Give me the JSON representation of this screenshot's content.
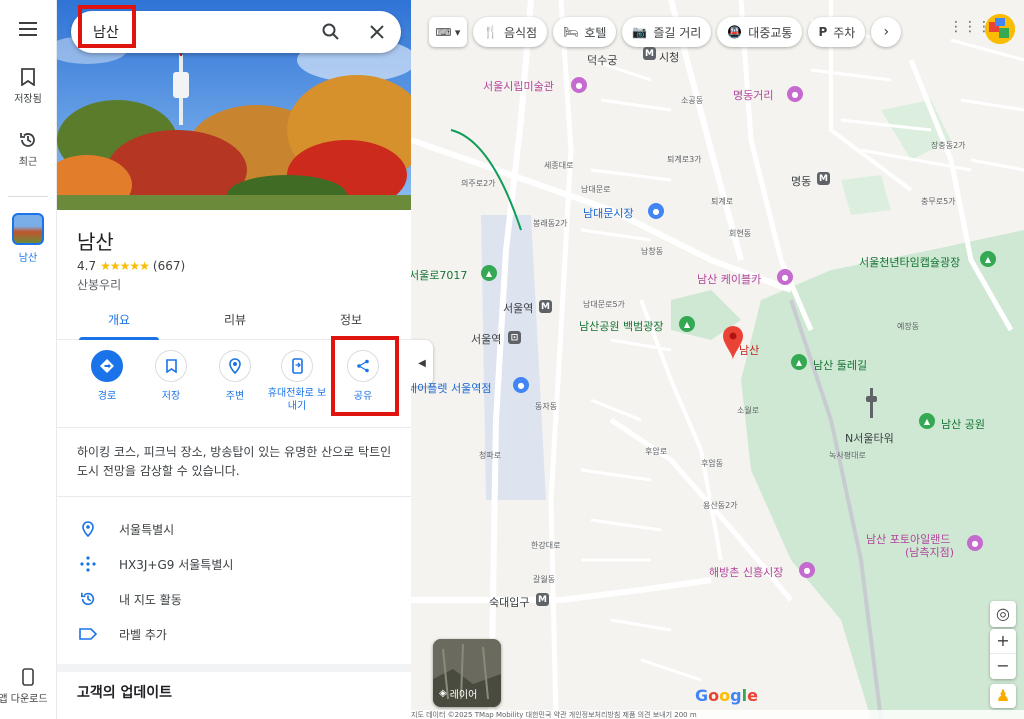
{
  "rail": {
    "saved_label": "저장됨",
    "recent_label": "최근",
    "place_label": "남산",
    "download_label": "앱 다운로드"
  },
  "search": {
    "query": "남산"
  },
  "place": {
    "name": "남산",
    "rating": "4.7",
    "stars": "★★★★★",
    "reviews": "(667)",
    "category": "산봉우리",
    "description": "하이킹 코스, 피크닉 장소, 방송탑이 있는 유명한 산으로 탁트인 도시 전망을 감상할 수 있습니다."
  },
  "tabs": [
    {
      "label": "개요"
    },
    {
      "label": "리뷰"
    },
    {
      "label": "정보"
    }
  ],
  "actions": [
    {
      "label": "경로",
      "icon": "directions-icon"
    },
    {
      "label": "저장",
      "icon": "bookmark-icon"
    },
    {
      "label": "주변",
      "icon": "nearby-icon"
    },
    {
      "label": "휴대전화로 보내기",
      "icon": "phone-icon"
    },
    {
      "label": "공유",
      "icon": "share-icon"
    }
  ],
  "info": [
    {
      "text": "서울특별시",
      "icon": "pin-icon"
    },
    {
      "text": "HX3J+G9 서울특별시",
      "icon": "pluscode-icon"
    },
    {
      "text": "내 지도 활동",
      "icon": "history-icon"
    },
    {
      "text": "라벨 추가",
      "icon": "label-icon"
    }
  ],
  "updates_title": "고객의 업데이트",
  "map": {
    "chips": [
      {
        "label": "음식점",
        "icon": "restaurant-icon"
      },
      {
        "label": "호텔",
        "icon": "hotel-icon"
      },
      {
        "label": "즐길 거리",
        "icon": "camera-icon"
      },
      {
        "label": "대중교통",
        "icon": "transit-icon"
      },
      {
        "label": "주차",
        "icon": "parking-icon"
      }
    ],
    "layer_label": "레이어",
    "google": "Google",
    "footer": "지도 데이터 ©2025 TMap Mobility   대한민국   약관   개인정보처리방침   제품 의견 보내기   200 m",
    "labels": {
      "deoksugung": "덕수궁",
      "sicheong": "시청",
      "museum": "서울시립미술관",
      "myeongdong_street": "명동거리",
      "namdaemun_market": "남대문시장",
      "seoul7017": "서울로7017",
      "seoul_station_metro": "서울역",
      "seoul_station": "서울역",
      "cable_car": "남산 케이블카",
      "baekbeom": "남산공원 백범광장",
      "namsan_pin": "남산",
      "dulle": "남산 둘레길",
      "seoul_tower": "N서울타워",
      "namsan_park": "남산 공원",
      "cheonnyeon": "서울천년타임캡슐광장",
      "photo_island": "남산 포토아일랜드",
      "namcheuk": "(남측지점)",
      "haebangchon": "해방촌 신흥시장",
      "sookdae": "숙대입구",
      "myeongdong": "명동",
      "seoul_plaza": "세이플렛 서울역점",
      "sungnyemun": "남대문로5가",
      "toegyero": "퇴계로",
      "sejongdaero": "세종대로",
      "namdaemunro": "남대문로",
      "hangangdaero": "한강대로",
      "cheongpaero": "청파로",
      "huam": "후암로",
      "sopawollo": "소월로",
      "noksapyeong": "녹사평대로",
      "uiju": "의주로2가",
      "toegye3": "퇴계로3가",
      "yejang": "예장동",
      "hoehyeon": "회현동",
      "namchang": "남창동",
      "bongnae": "봉래동2가",
      "galwol": "갈월동",
      "yongsan2": "용산동2가",
      "huamdong": "후암동",
      "dongja": "동자동",
      "chungmuro": "충무로5가",
      "sogong": "소공동",
      "jangchung": "장충동2가"
    }
  }
}
